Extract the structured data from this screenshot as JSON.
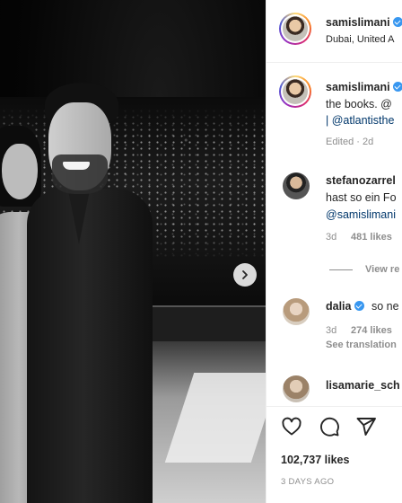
{
  "post": {
    "author": "samislimani",
    "location": "Dubai, United A",
    "caption_author": "samislimani",
    "caption_line1": "the books. @",
    "caption_line2": "| @atlantisthe",
    "caption_meta": "Edited · 2d"
  },
  "comments": [
    {
      "user": "stefanozarrel",
      "line1": "hast so ein Fo",
      "line2": "@samislimani",
      "time": "3d",
      "likes": "481 likes"
    },
    {
      "user": "dalia",
      "text": "so ne",
      "time": "3d",
      "likes": "274 likes",
      "see_translation": "See translation"
    },
    {
      "user": "lisamarie_sch"
    }
  ],
  "view_replies": "View re",
  "footer": {
    "likes": "102,737 likes",
    "date": "3 DAYS AGO"
  },
  "icons": [
    "heart-icon",
    "comment-icon",
    "share-icon",
    "chevron-right-icon",
    "verified-icon"
  ],
  "colors": {
    "link": "#00376b",
    "verified": "#3897f0",
    "muted": "#8e8e8e"
  }
}
